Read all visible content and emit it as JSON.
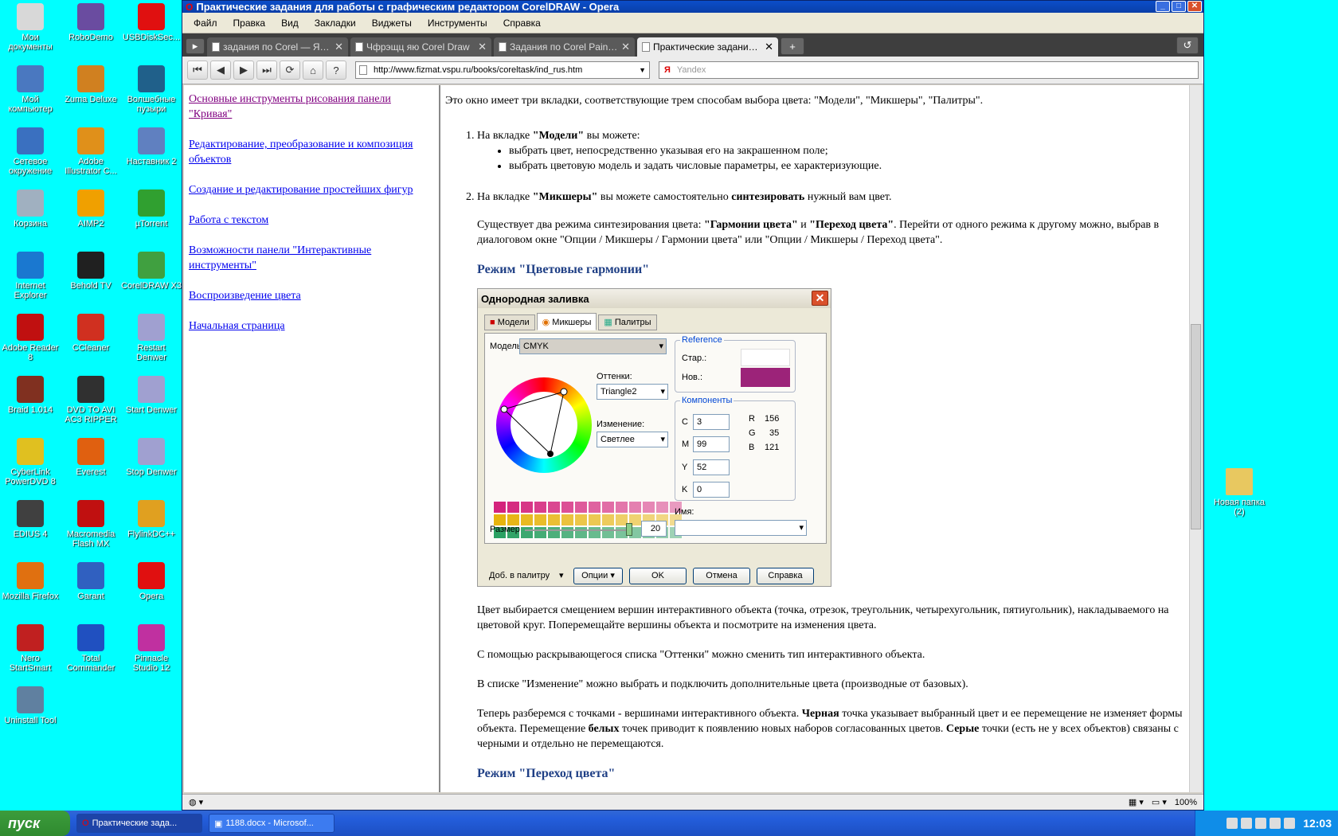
{
  "desktop_icons": [
    {
      "label": "Мои документы",
      "icon": "folder-icon",
      "color": "#d8d8d8"
    },
    {
      "label": "RoboDemo",
      "icon": "robodemo-icon",
      "color": "#6a4ca0"
    },
    {
      "label": "USBDiskSec...",
      "icon": "usb-icon",
      "color": "#e01010"
    },
    {
      "label": "Мой компьютер",
      "icon": "computer-icon",
      "color": "#4a78c0"
    },
    {
      "label": "Zuma Deluxe",
      "icon": "zuma-icon",
      "color": "#d08020"
    },
    {
      "label": "Волшебные пузыри",
      "icon": "bubbles-icon",
      "color": "#20608a"
    },
    {
      "label": "Сетевое окружение",
      "icon": "network-icon",
      "color": "#3a70c0"
    },
    {
      "label": "Adobe Illustrator C...",
      "icon": "illustrator-icon",
      "color": "#e0901a"
    },
    {
      "label": "Наставник 2",
      "icon": "tutor-icon",
      "color": "#6080c0"
    },
    {
      "label": "Корзина",
      "icon": "trash-icon",
      "color": "#a0b0c0"
    },
    {
      "label": "AIMP2",
      "icon": "aimp-icon",
      "color": "#f0a000"
    },
    {
      "label": "µTorrent",
      "icon": "utorrent-icon",
      "color": "#30a030"
    },
    {
      "label": "Internet Explorer",
      "icon": "ie-icon",
      "color": "#1a78d0"
    },
    {
      "label": "Behold TV",
      "icon": "tv-icon",
      "color": "#202020"
    },
    {
      "label": "CorelDRAW X3",
      "icon": "coreldraw-icon",
      "color": "#40a040"
    },
    {
      "label": "Adobe Reader 8",
      "icon": "reader-icon",
      "color": "#c01010"
    },
    {
      "label": "CCleaner",
      "icon": "ccleaner-icon",
      "color": "#d03020"
    },
    {
      "label": "Restart Denwer",
      "icon": "denwer-icon",
      "color": "#a0a0d0"
    },
    {
      "label": "Braid 1.014",
      "icon": "braid-icon",
      "color": "#803020"
    },
    {
      "label": "DVD TO AVI AC3 RIPPER",
      "icon": "dvd-icon",
      "color": "#303030"
    },
    {
      "label": "Start Denwer",
      "icon": "denwer-icon",
      "color": "#a0a0d0"
    },
    {
      "label": "CyberLink PowerDVD 8",
      "icon": "powerdvd-icon",
      "color": "#e0c020"
    },
    {
      "label": "Everest",
      "icon": "everest-icon",
      "color": "#e06010"
    },
    {
      "label": "Stop Denwer",
      "icon": "denwer-icon",
      "color": "#a0a0d0"
    },
    {
      "label": "EDIUS 4",
      "icon": "edius-icon",
      "color": "#404040"
    },
    {
      "label": "Macromedia Flash MX",
      "icon": "flash-icon",
      "color": "#c01010"
    },
    {
      "label": "FlylinkDC++",
      "icon": "flylink-icon",
      "color": "#e0a020"
    },
    {
      "label": "Mozilla Firefox",
      "icon": "firefox-icon",
      "color": "#e07010"
    },
    {
      "label": "Garant",
      "icon": "garant-icon",
      "color": "#3060c0"
    },
    {
      "label": "Opera",
      "icon": "opera-icon",
      "color": "#e01010"
    },
    {
      "label": "Nero StartSmart",
      "icon": "nero-icon",
      "color": "#c02020"
    },
    {
      "label": "Total Commander",
      "icon": "totalcmd-icon",
      "color": "#2050c0"
    },
    {
      "label": "Pinnacle Studio 12",
      "icon": "pinnacle-icon",
      "color": "#c030a0"
    },
    {
      "label": "Uninstall Tool",
      "icon": "uninstall-icon",
      "color": "#6080a0"
    }
  ],
  "right_icon": {
    "label": "Новая папка (2)"
  },
  "window": {
    "title": "Практические задания для работы с графическим редактором CorelDRAW - Opera",
    "menu": [
      "Файл",
      "Правка",
      "Вид",
      "Закладки",
      "Виджеты",
      "Инструменты",
      "Справка"
    ],
    "tabs": [
      {
        "label": "задания по Corel — Ян..."
      },
      {
        "label": "Чфрэщц яю Corel Draw"
      },
      {
        "label": "Задания по Corel Painte..."
      },
      {
        "label": "Практические задания..."
      }
    ],
    "address": "http://www.fizmat.vspu.ru/books/coreltask/ind_rus.htm",
    "search_placeholder": "Yandex",
    "search_brand": "Я",
    "zoom": "100%"
  },
  "leftnav": [
    {
      "text": "Основные инструменты рисования панели \"Кривая\"",
      "visited": true
    },
    {
      "text": "Редактирование, преобразование и композиция объектов",
      "visited": false
    },
    {
      "text": "Создание и редактирование простейших фигур",
      "visited": false
    },
    {
      "text": "Работа с текстом",
      "visited": false
    },
    {
      "text": "Возможности панели \"Интерактивные инструменты\"",
      "visited": false
    },
    {
      "text": "Воспроизведение цвета",
      "visited": false
    },
    {
      "text": "Начальная страница",
      "visited": false
    }
  ],
  "main": {
    "intro": "Это окно имеет три вкладки, соответствующие трем способам выбора цвета: \"Модели\", \"Микшеры\", \"Палитры\".",
    "li1_pre": "На вкладке ",
    "li1_bold": "\"Модели\"",
    "li1_post": " вы можете:",
    "li1_sub": [
      "выбрать цвет, непосредственно указывая его на закрашенном поле;",
      "выбрать цветовую модель и задать числовые параметры, ее характеризующие."
    ],
    "li2_pre": "На вкладке ",
    "li2_bold": "\"Микшеры\"",
    "li2_mid": " вы можете самостоятельно ",
    "li2_bold2": "синтезировать",
    "li2_post": " нужный вам цвет.",
    "p_modes_pre": "Существует два режима синтезирования цвета: ",
    "p_modes_b1": "\"Гармонии цвета\"",
    "p_modes_and": " и ",
    "p_modes_b2": "\"Переход цвета\"",
    "p_modes_post": ". Перейти от одного режима к другому можно, выбрав в диалоговом окне \"Опции / Микшеры / Гармонии цвета\" или \"Опции / Микшеры / Переход цвета\".",
    "h_harmony": "Режим \"Цветовые гармонии\"",
    "p_vertices": "Цвет выбирается смещением вершин интерактивного объекта (точка, отрезок, треугольник, четырехугольник, пятиугольник), накладываемого на цветовой круг. Поперемещайте вершины объекта и посмотрите на изменения цвета.",
    "p_shades": "С помощью раскрывающегося списка \"Оттенки\" можно сменить тип интерактивного объекта.",
    "p_change": "В списке \"Изменение\" можно выбрать и подключить дополнительные цвета (производные от базовых).",
    "p_points_1": "Теперь разберемся с точками - вершинами интерактивного объекта. ",
    "p_points_b1": "Черная",
    "p_points_2": " точка указывает выбранный цвет и ее перемещение не изменяет формы объекта. Перемещение ",
    "p_points_b2": "белых",
    "p_points_3": " точек приводит к появлению новых наборов согласованных цветов. ",
    "p_points_b3": "Серые",
    "p_points_4": " точки (есть не у всех объектов) связаны с черными и отдельно не перемещаются.",
    "h_transition": "Режим \"Переход цвета\""
  },
  "dialog": {
    "title": "Однородная заливка",
    "tabs": [
      "Модели",
      "Микшеры",
      "Палитры"
    ],
    "model_label": "Модель",
    "model_value": "CMYK",
    "shades_label": "Оттенки:",
    "shades_value": "Triangle2",
    "change_label": "Изменение:",
    "change_value": "Светлее",
    "reference_label": "Reference",
    "old_label": "Стар.:",
    "new_label": "Нов.:",
    "new_color": "#9c2379",
    "components_label": "Компоненты",
    "c_label": "C",
    "c_value": "3",
    "m_label": "M",
    "m_value": "99",
    "y_label": "Y",
    "y_value": "52",
    "k_label": "K",
    "k_value": "0",
    "r_label": "R",
    "r_value": "156",
    "g_label": "G",
    "g_value": "35",
    "b_label": "B",
    "b_value": "121",
    "name_label": "Имя:",
    "size_label": "Размер",
    "size_value": "20",
    "add_palette": "Доб. в палитру",
    "options": "Опции",
    "ok": "OK",
    "cancel": "Отмена",
    "help": "Справка",
    "grid_colors": [
      "#d4237d",
      "#e7b40e",
      "#2aa163"
    ]
  },
  "taskbar": {
    "start": "пуск",
    "tasks": [
      "Практические зада...",
      "1188.docx - Microsof..."
    ],
    "clock": "12:03"
  }
}
